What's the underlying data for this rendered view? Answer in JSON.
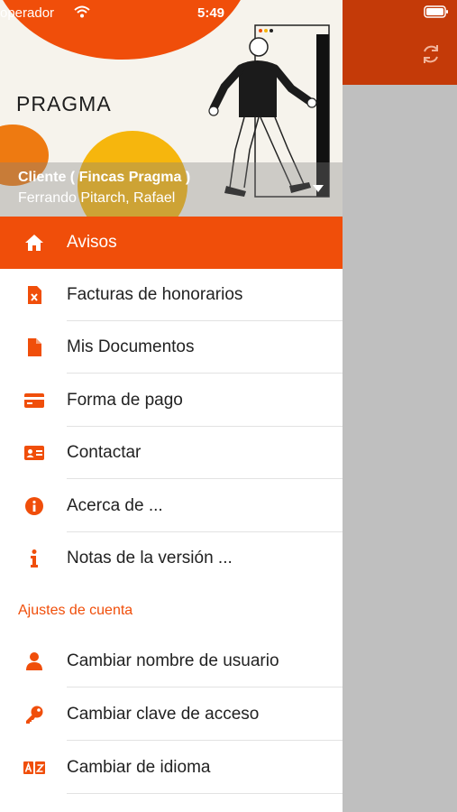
{
  "status_bar": {
    "carrier": "operador",
    "time": "5:49"
  },
  "header": {
    "logo": "PRAGMA",
    "client": "Cliente ( Fincas Pragma )",
    "user": "Ferrando Pitarch, Rafael"
  },
  "menu": {
    "items": [
      {
        "label": "Avisos",
        "icon": "home-icon"
      },
      {
        "label": "Facturas de honorarios",
        "icon": "invoice-icon"
      },
      {
        "label": "Mis Documentos",
        "icon": "document-icon"
      },
      {
        "label": "Forma de pago",
        "icon": "credit-card-icon"
      },
      {
        "label": "Contactar",
        "icon": "contact-card-icon"
      },
      {
        "label": "Acerca de ...",
        "icon": "info-circle-icon"
      },
      {
        "label": "Notas de la versión ...",
        "icon": "info-icon"
      }
    ],
    "section_title": "Ajustes de cuenta",
    "account_items": [
      {
        "label": "Cambiar nombre de usuario",
        "icon": "user-icon"
      },
      {
        "label": "Cambiar clave de acceso",
        "icon": "key-icon"
      },
      {
        "label": "Cambiar de idioma",
        "icon": "language-icon"
      }
    ]
  },
  "colors": {
    "accent": "#f04e0a",
    "app_bar": "#c43a08"
  }
}
